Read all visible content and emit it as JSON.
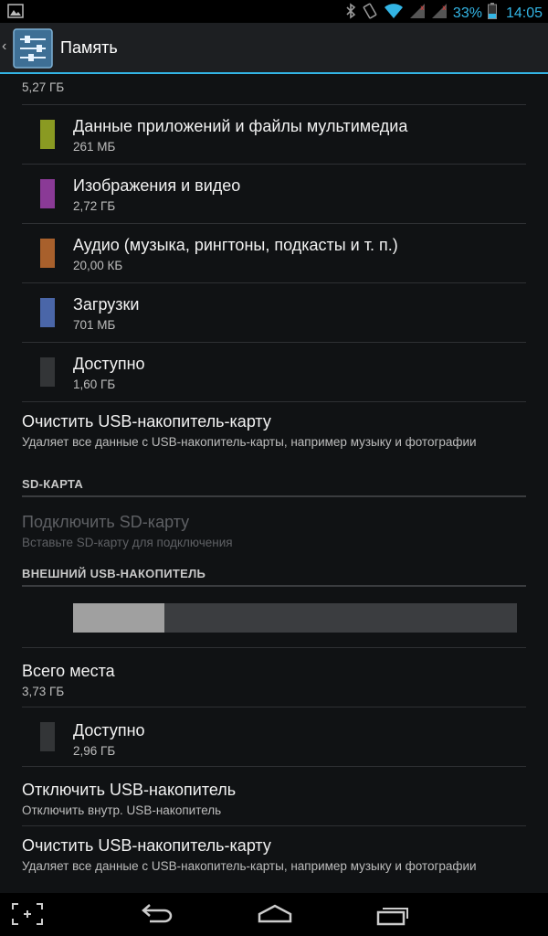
{
  "status_bar": {
    "battery_percent": "33%",
    "time": "14:05",
    "accent": "#33b5e5"
  },
  "action_bar": {
    "title": "Память",
    "icon": "settings-sliders-icon"
  },
  "storage": {
    "top_value": "5,27 ГБ",
    "categories": [
      {
        "title": "Данные приложений и файлы мультимедиа",
        "value": "261 МБ",
        "color": "#8a9a22"
      },
      {
        "title": "Изображения и видео",
        "value": "2,72 ГБ",
        "color": "#8a3a96"
      },
      {
        "title": "Аудио (музыка, рингтоны, подкасты и т. п.)",
        "value": "20,00 КБ",
        "color": "#a8602c"
      },
      {
        "title": "Загрузки",
        "value": "701 МБ",
        "color": "#4a66a8"
      },
      {
        "title": "Доступно",
        "value": "1,60 ГБ",
        "color": "#333537"
      }
    ],
    "erase": {
      "title": "Очистить USB-накопитель-карту",
      "summary": "Удаляет все данные с USB-накопитель-карты, например музыку и фотографии"
    }
  },
  "sd_card": {
    "header": "SD-КАРТА",
    "mount_title": "Подключить SD-карту",
    "mount_summary": "Вставьте SD-карту для подключения"
  },
  "external_usb": {
    "header": "ВНЕШНИЙ USB-НАКОПИТЕЛЬ",
    "used_fraction": 0.206,
    "bar_used_color": "#a0a0a0",
    "total_title": "Всего места",
    "total_value": "3,73 ГБ",
    "available_title": "Доступно",
    "available_value": "2,96 ГБ",
    "unmount_title": "Отключить USB-накопитель",
    "unmount_summary": "Отключить внутр. USB-накопитель",
    "erase_title": "Очистить USB-накопитель-карту",
    "erase_summary": "Удаляет все данные с USB-накопитель-карты, например музыку и фотографии"
  },
  "nav_bar": {
    "buttons": [
      "screenshot-icon",
      "back-icon",
      "home-icon",
      "recent-apps-icon"
    ]
  }
}
